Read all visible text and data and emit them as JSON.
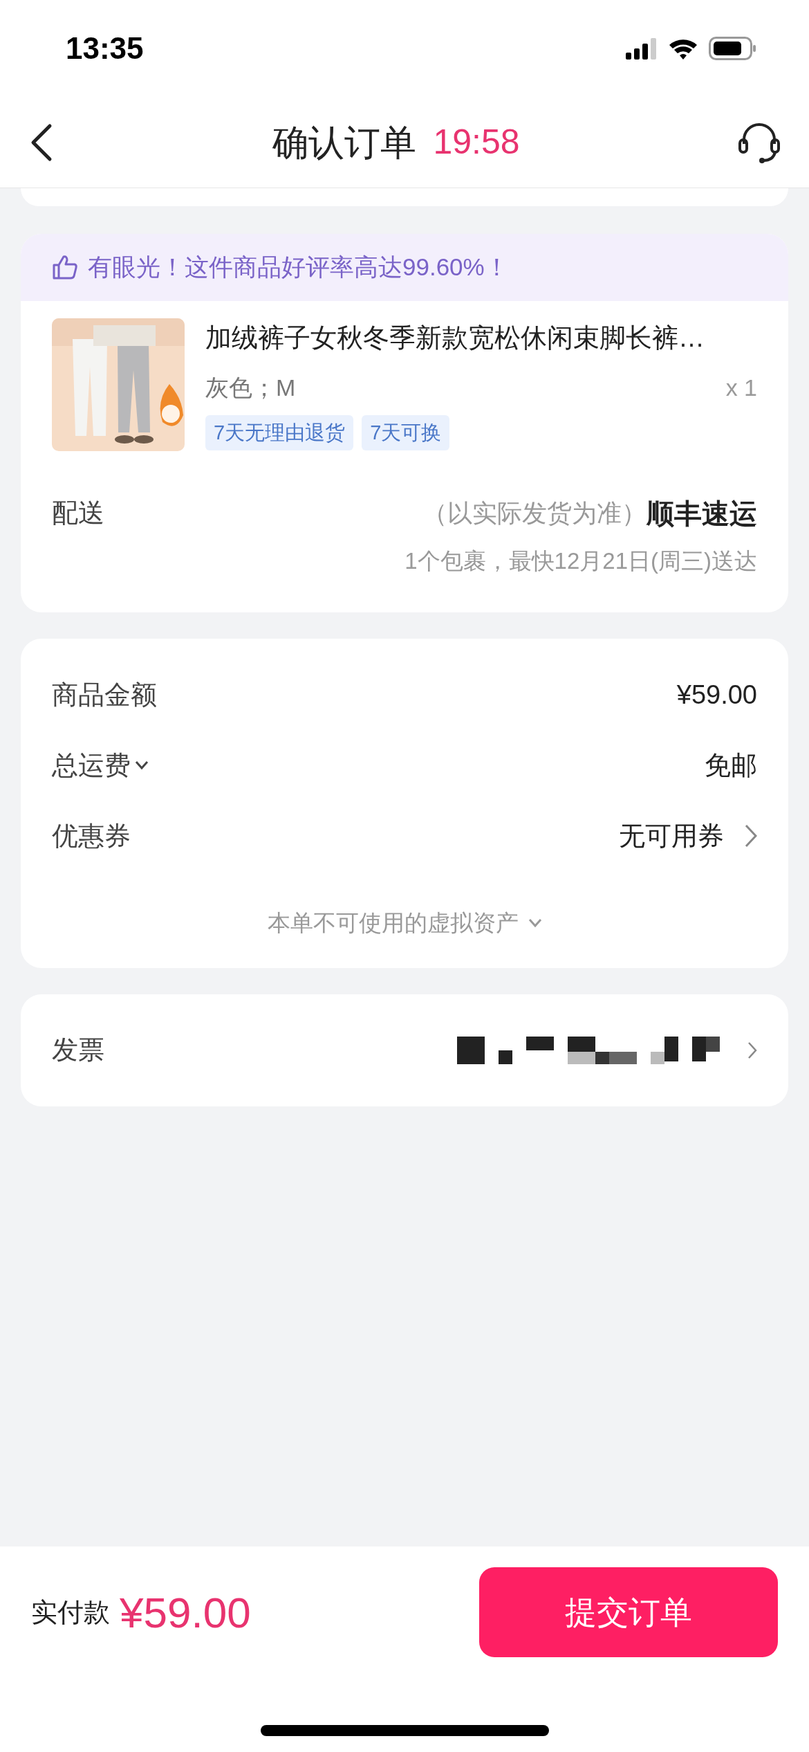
{
  "status_bar": {
    "time": "13:35"
  },
  "nav": {
    "title": "确认订单",
    "countdown": "19:58"
  },
  "banner": {
    "text": "有眼光！这件商品好评率高达99.60%！"
  },
  "product": {
    "kind": "picture",
    "title": "加绒裤子女秋冬季新款宽松休闲束脚长裤…",
    "spec": "灰色；M",
    "quantity": "x 1",
    "tags": [
      "7天无理由退货",
      "7天可换"
    ]
  },
  "delivery": {
    "label": "配送",
    "note": "（以实际发货为准）",
    "carrier": "顺丰速运",
    "estimate": "1个包裹，最快12月21日(周三)送达"
  },
  "costs": [
    {
      "label": "商品金额",
      "value": "¥59.00",
      "kind": "plain"
    },
    {
      "label": "总运费",
      "value": "免邮",
      "kind": "dropdown"
    },
    {
      "label": "优惠券",
      "value": "无可用券",
      "kind": "link"
    }
  ],
  "virtual_assets": {
    "label": "本单不可使用的虚拟资产"
  },
  "invoice": {
    "label": "发票"
  },
  "footer": {
    "label": "实付款",
    "amount": "¥59.00",
    "submit": "提交订单"
  }
}
